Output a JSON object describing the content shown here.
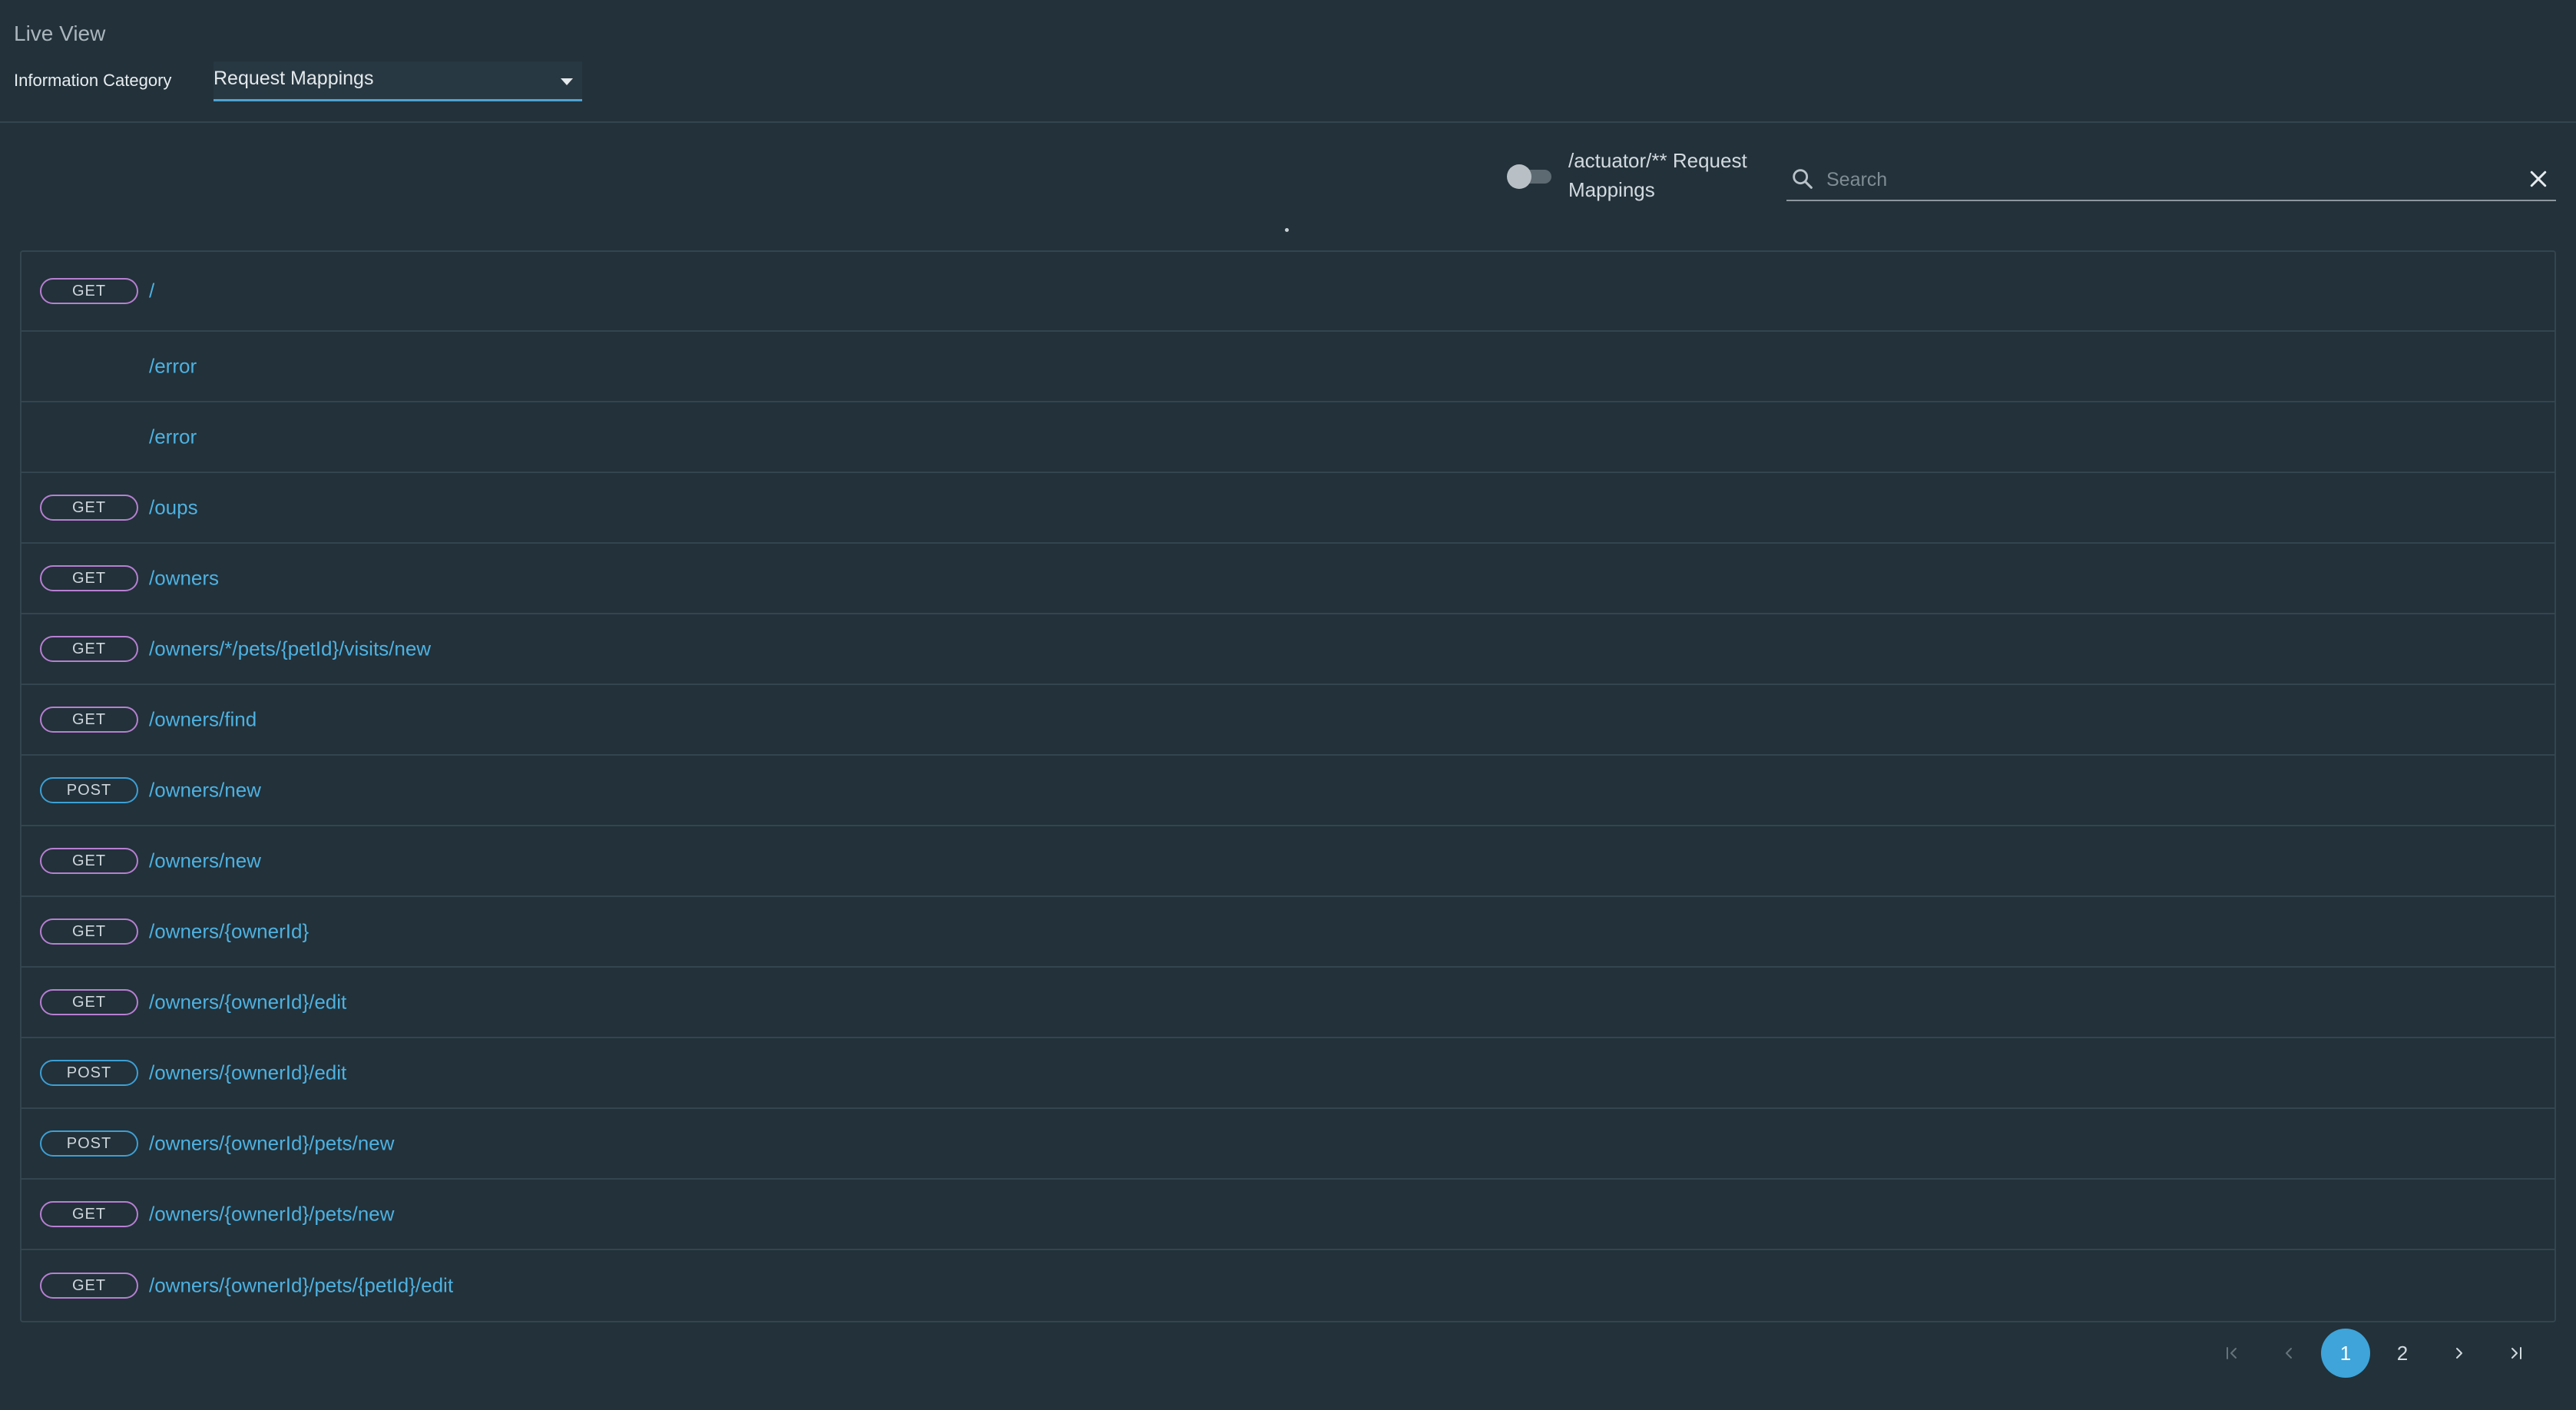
{
  "header": {
    "title": "Live View",
    "category_label": "Information Category",
    "category_value": "Request Mappings"
  },
  "filter": {
    "toggle_label": "/actuator/** Request Mappings",
    "toggle_on": false,
    "search_placeholder": "Search"
  },
  "mappings": [
    {
      "method": "GET",
      "path": "/"
    },
    {
      "method": "",
      "path": "/error"
    },
    {
      "method": "",
      "path": "/error"
    },
    {
      "method": "GET",
      "path": "/oups"
    },
    {
      "method": "GET",
      "path": "/owners"
    },
    {
      "method": "GET",
      "path": "/owners/*/pets/{petId}/visits/new"
    },
    {
      "method": "GET",
      "path": "/owners/find"
    },
    {
      "method": "POST",
      "path": "/owners/new"
    },
    {
      "method": "GET",
      "path": "/owners/new"
    },
    {
      "method": "GET",
      "path": "/owners/{ownerId}"
    },
    {
      "method": "GET",
      "path": "/owners/{ownerId}/edit"
    },
    {
      "method": "POST",
      "path": "/owners/{ownerId}/edit"
    },
    {
      "method": "POST",
      "path": "/owners/{ownerId}/pets/new"
    },
    {
      "method": "GET",
      "path": "/owners/{ownerId}/pets/new"
    },
    {
      "method": "GET",
      "path": "/owners/{ownerId}/pets/{petId}/edit"
    }
  ],
  "pagination": {
    "pages": [
      "1",
      "2"
    ],
    "current": "1"
  },
  "colors": {
    "get_badge": "#b77fd1",
    "post_badge": "#3d9fd4",
    "link": "#4eb1e0",
    "active_page": "#3ea4d9"
  }
}
